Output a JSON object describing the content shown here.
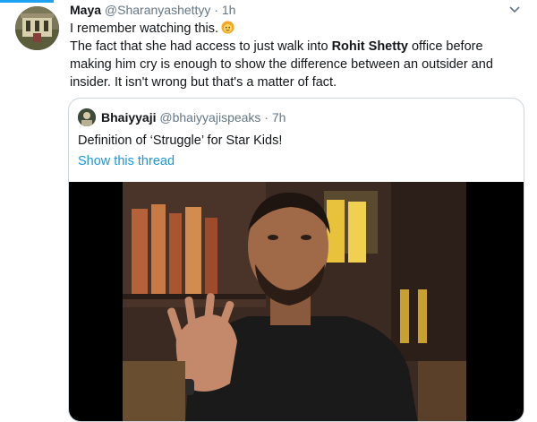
{
  "tweet": {
    "author_name": "Maya",
    "author_handle": "@Sharanyashettyy",
    "separator": "·",
    "time": "1h",
    "line1": "I remember watching this.",
    "body_before": "The fact that she had access to just walk into ",
    "body_bold": "Rohit Shetty",
    "body_after": " office before making him cry is enough to show the difference between an outsider and insider. It isn't wrong but that's a matter of fact."
  },
  "quoted": {
    "author_name": "Bhaiyyaji",
    "author_handle": "@bhaiyyajispeaks",
    "separator": "·",
    "time": "7h",
    "text": "Definition of ‘Struggle’ for Star Kids!",
    "thread_link": "Show this thread"
  },
  "icons": [
    "chevron-down-icon",
    "emoji-icon"
  ],
  "colors": {
    "accent": "#1da1f2",
    "link": "#1b95e0",
    "muted": "#657786",
    "border": "#ccd6dd"
  }
}
